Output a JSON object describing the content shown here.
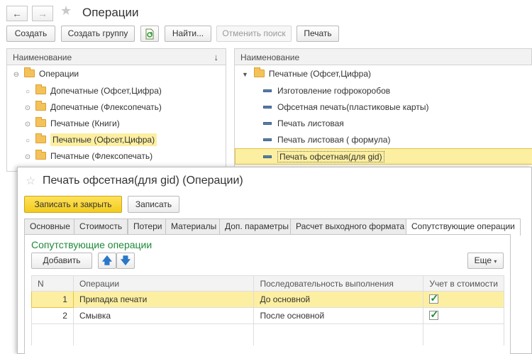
{
  "window": {
    "title": "Операции"
  },
  "toolbar": {
    "create": "Создать",
    "create_group": "Создать группу",
    "find": "Найти...",
    "cancel_search": "Отменить поиск",
    "print": "Печать"
  },
  "left_panel": {
    "header": "Наименование",
    "sort_icon": "↓",
    "items": [
      {
        "label": "Операции",
        "marker": "⊖"
      },
      {
        "label": "Допечатные (Офсет,Цифра)",
        "marker": "○"
      },
      {
        "label": "Допечатные (Флексопечать)",
        "marker": "⊙"
      },
      {
        "label": "Печатные (Книги)",
        "marker": "⊙"
      },
      {
        "label": "Печатные (Офсет,Цифра)",
        "marker": "○"
      },
      {
        "label": "Печатные (Флексопечать)",
        "marker": "⊙"
      }
    ]
  },
  "right_panel": {
    "header": "Наименование",
    "parent": "Печатные (Офсет,Цифра)",
    "items": [
      "Изготовление гофрокоробов",
      "Офсетная печать(пластиковые карты)",
      "Печать листовая",
      "Печать листовая ( формула)",
      "Печать офсетная(для gid)"
    ]
  },
  "dialog": {
    "title": "Печать офсетная(для gid) (Операции)",
    "save_close": "Записать и закрыть",
    "save": "Записать",
    "tabs": [
      "Основные",
      "Стоимость",
      "Потери",
      "Материалы",
      "Доп. параметры",
      "Расчет выходного формата",
      "Сопутствующие операции"
    ],
    "section_title": "Сопутствующие операции",
    "add": "Добавить",
    "more": "Еще",
    "more_arrow": "▾",
    "columns": [
      "N",
      "Операции",
      "Последовательность выполнения",
      "Учет в стоимости"
    ],
    "rows": [
      {
        "n": "1",
        "op": "Припадка печати",
        "seq": "До основной",
        "cost": true
      },
      {
        "n": "2",
        "op": "Смывка",
        "seq": "После основной",
        "cost": true
      }
    ]
  },
  "colors": {
    "selection": "#fcefa1",
    "primary_button": "#f3cb1f",
    "section_title": "#1f8a3b"
  }
}
